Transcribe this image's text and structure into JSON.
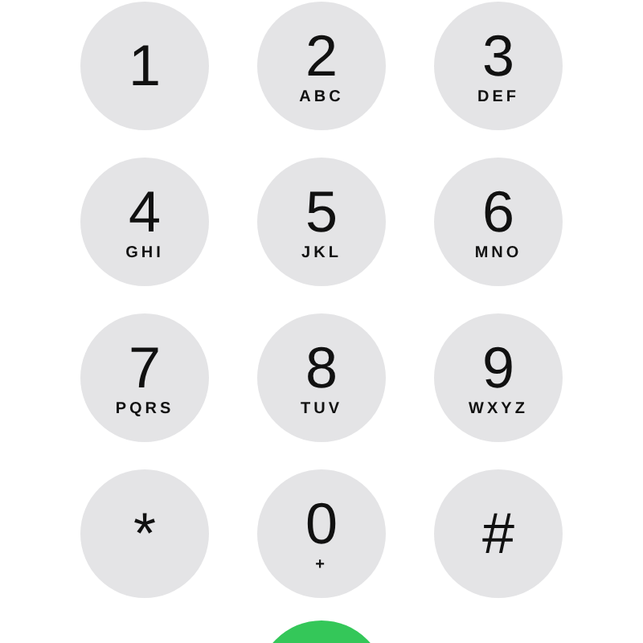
{
  "keypad": [
    {
      "digit": "1"
    },
    {
      "digit": "2",
      "letters": "ABC"
    },
    {
      "digit": "3",
      "letters": "DEF"
    },
    {
      "digit": "4",
      "letters": "GHI"
    },
    {
      "digit": "5",
      "letters": "JKL"
    },
    {
      "digit": "6",
      "letters": "MNO"
    },
    {
      "digit": "7",
      "letters": "PQRS"
    },
    {
      "digit": "8",
      "letters": "TUV"
    },
    {
      "digit": "9",
      "letters": "WXYZ"
    },
    {
      "digit": "*"
    },
    {
      "digit": "0",
      "letters": "+"
    },
    {
      "digit": "#"
    }
  ]
}
